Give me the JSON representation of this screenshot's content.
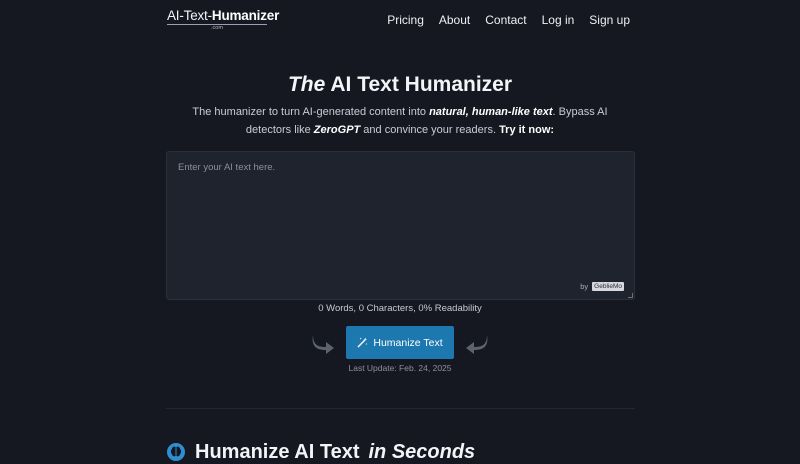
{
  "header": {
    "logo": {
      "part1": "AI-Text-",
      "part2": "Humanizer",
      "sub": ".com"
    },
    "nav": [
      "Pricing",
      "About",
      "Contact",
      "Log in",
      "Sign up"
    ]
  },
  "hero": {
    "title_em": "The",
    "title_rest": " AI Text Humanizer",
    "desc": {
      "t1": "The humanizer to turn AI-generated content into ",
      "hl1": "natural, human-like text",
      "t2": ". Bypass AI detectors like ",
      "hl2": "ZeroGPT",
      "t3": " and convince your readers. ",
      "cta": "Try it now:"
    }
  },
  "editor": {
    "placeholder": "Enter your AI text here.",
    "by_label": "by",
    "by_badge": "GeblieMo"
  },
  "stats": "0 Words, 0 Characters, 0% Readability",
  "humanize_button": "Humanize Text",
  "last_update": "Last Update: Feb. 24, 2025",
  "section": {
    "title_start": "Humanize AI Text ",
    "title_em": "in Seconds"
  },
  "colors": {
    "background": "#151821",
    "accent": "#1c78ae",
    "editor_bg": "#1f232d"
  },
  "icons": {
    "button": "magic-wand-icon",
    "section": "brain-icon",
    "arrows": "curved-arrow-icon"
  }
}
